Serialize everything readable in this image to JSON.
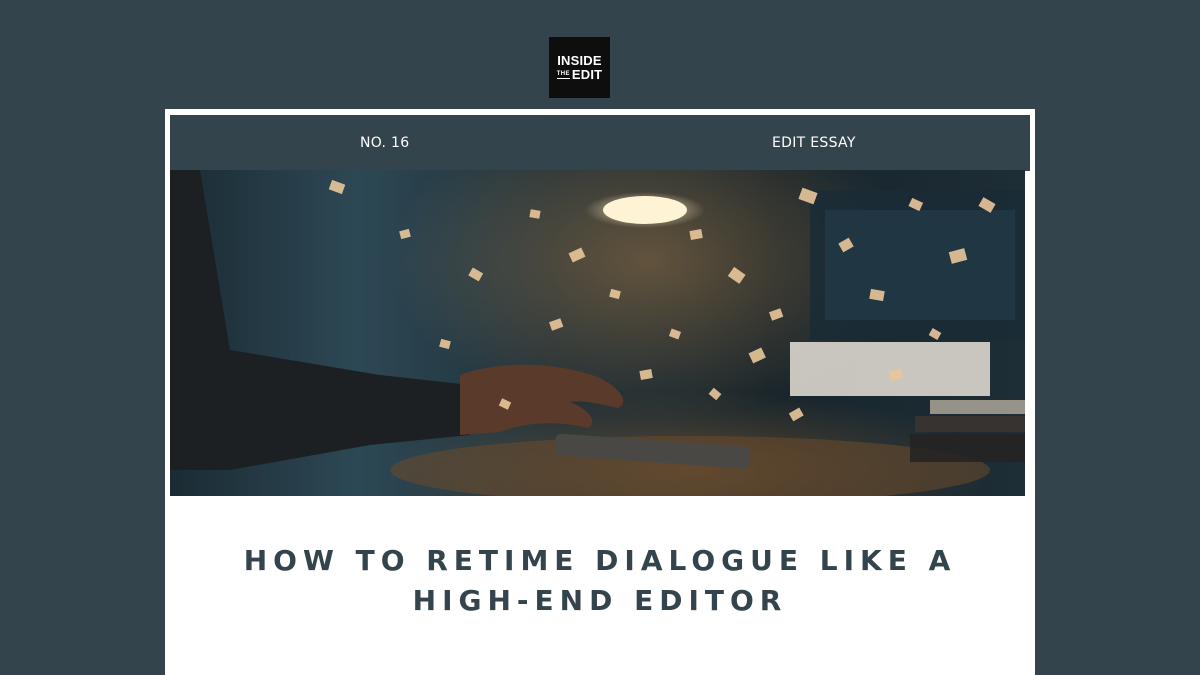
{
  "brand": {
    "logo_line1": "INSIDE",
    "logo_line2a": "THE",
    "logo_line2b": "EDIT"
  },
  "header": {
    "issue": "NO. 16",
    "category": "EDIT ESSAY"
  },
  "hero": {
    "icon": "hero-photo"
  },
  "article": {
    "title_line1": "HOW TO RETIME DIALOGUE LIKE A",
    "title_line2": "HIGH-END EDITOR"
  },
  "colors": {
    "background": "#33444c",
    "card": "#ffffff",
    "title": "#33444c"
  }
}
